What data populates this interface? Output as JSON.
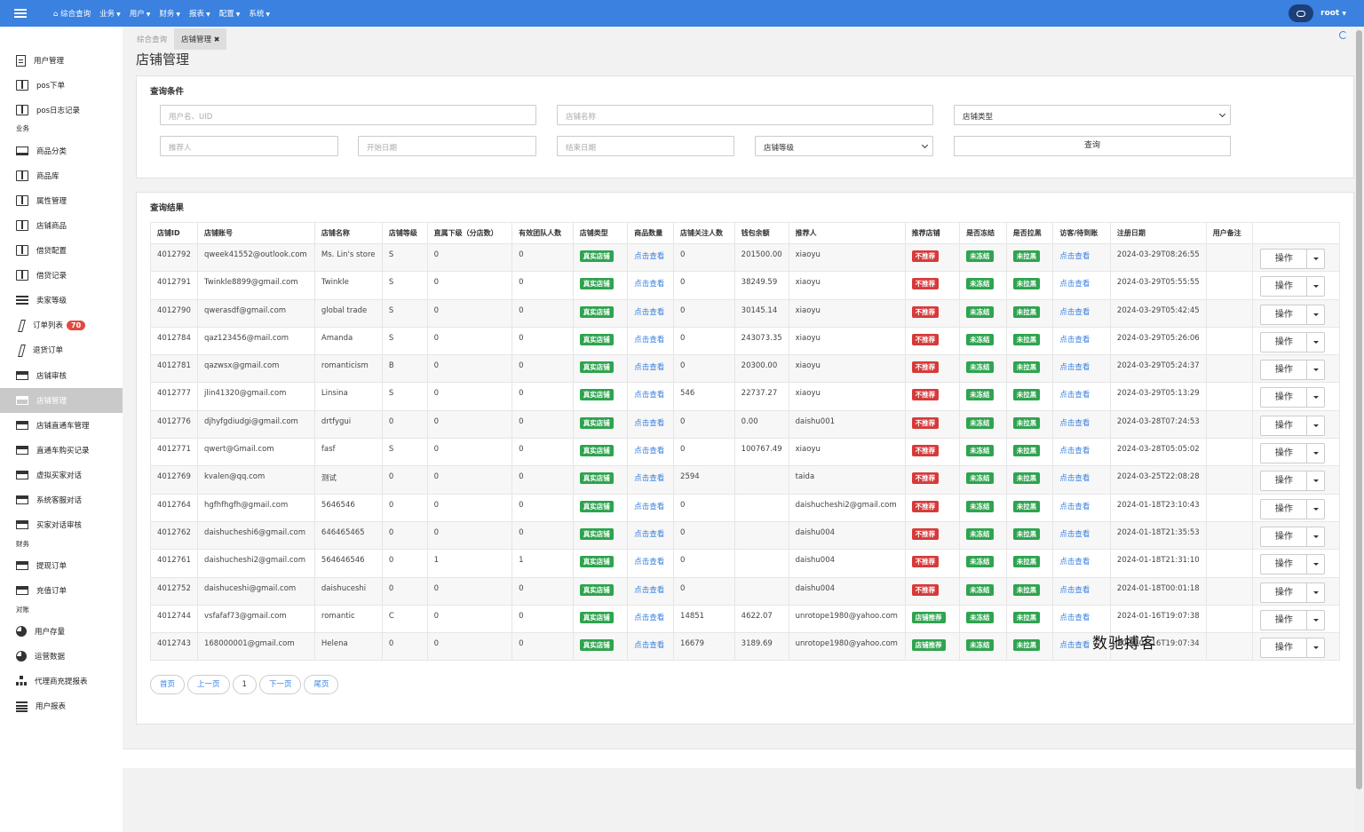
{
  "topbar": {
    "nav": [
      {
        "label": "综合查询",
        "icon": "home-icon",
        "caret": false
      },
      {
        "label": "业务",
        "caret": true
      },
      {
        "label": "用户",
        "caret": true
      },
      {
        "label": "财务",
        "caret": true
      },
      {
        "label": "报表",
        "caret": true
      },
      {
        "label": "配置",
        "caret": true
      },
      {
        "label": "系统",
        "caret": true
      }
    ],
    "user": "root",
    "accent_color": "#3a81e0"
  },
  "sidebar": {
    "items": [
      {
        "label": "用户管理",
        "icon": "file-icon"
      },
      {
        "label": "pos下单",
        "icon": "book-icon"
      },
      {
        "label": "pos日志记录",
        "icon": "book-icon"
      },
      {
        "label": "商品分类",
        "icon": "laptop-icon"
      },
      {
        "label": "商品库",
        "icon": "book-icon"
      },
      {
        "label": "属性管理",
        "icon": "book-icon"
      },
      {
        "label": "店铺商品",
        "icon": "book-icon"
      },
      {
        "label": "借贷配置",
        "icon": "book-icon"
      },
      {
        "label": "借贷记录",
        "icon": "book-icon"
      },
      {
        "label": "卖家等级",
        "icon": "list-icon"
      },
      {
        "label": "订单列表",
        "icon": "edit-icon",
        "badge": "70"
      },
      {
        "label": "退货订单",
        "icon": "edit-icon"
      },
      {
        "label": "店铺审核",
        "icon": "credit-card-icon"
      },
      {
        "label": "店铺管理",
        "icon": "credit-card-icon",
        "active": true
      },
      {
        "label": "店铺直通车管理",
        "icon": "credit-card-icon"
      },
      {
        "label": "直通车购买记录",
        "icon": "credit-card-icon"
      },
      {
        "label": "虚拟买家对话",
        "icon": "credit-card-icon"
      },
      {
        "label": "系统客服对话",
        "icon": "credit-card-icon"
      },
      {
        "label": "买家对话审核",
        "icon": "credit-card-icon"
      },
      {
        "label": "提现订单",
        "icon": "credit-card-icon"
      },
      {
        "label": "充值订单",
        "icon": "credit-card-icon"
      },
      {
        "label": "用户存量",
        "icon": "pie-chart-icon"
      },
      {
        "label": "运营数据",
        "icon": "pie-chart-icon"
      },
      {
        "label": "代理商充提报表",
        "icon": "sitemap-icon"
      },
      {
        "label": "用户报表",
        "icon": "align-left-icon"
      }
    ],
    "sections": [
      "业务",
      "财务",
      "对账"
    ]
  },
  "tabs": [
    {
      "label": "综合查询"
    },
    {
      "label": "店铺管理",
      "close": "✖"
    }
  ],
  "page_title": "店铺管理",
  "query": {
    "title": "查询条件",
    "user_placeholder": "用户名、UID",
    "shop_name_placeholder": "店铺名称",
    "shop_type_value": "店铺类型",
    "referrer_placeholder": "推荐人",
    "start_date_placeholder": "开始日期",
    "end_date_placeholder": "结束日期",
    "shop_level_value": "店铺等级",
    "search_label": "查询"
  },
  "results": {
    "title": "查询结果",
    "columns": [
      "店铺ID",
      "店铺账号",
      "店铺名称",
      "店铺等级",
      "直属下级（分店数）",
      "有效团队人数",
      "店铺类型",
      "商品数量",
      "店铺关注人数",
      "钱包余额",
      "推荐人",
      "推荐店铺",
      "是否冻结",
      "是否拉黑",
      "访客/待到账",
      "注册日期",
      "用户备注",
      ""
    ],
    "op_label": "操作",
    "rows": [
      {
        "id": "4012792",
        "account": "qweek41552@outlook.com",
        "name": "Ms. Lin's store",
        "level": "S",
        "subs": "0",
        "team": "0",
        "type": "真实店铺",
        "goods": "点击查看",
        "followers": "0",
        "balance": "201500.00",
        "referrer": "xiaoyu",
        "recommend": "不推荐",
        "recommend_color": "red",
        "frozen": "未冻结",
        "blacklist": "未拉黑",
        "visitors": "点击查看",
        "date": "2024-03-29T08:26:55",
        "note": ""
      },
      {
        "id": "4012791",
        "account": "Twinkle8899@gmail.com",
        "name": "Twinkle",
        "level": "S",
        "subs": "0",
        "team": "0",
        "type": "真实店铺",
        "goods": "点击查看",
        "followers": "0",
        "balance": "38249.59",
        "referrer": "xiaoyu",
        "recommend": "不推荐",
        "recommend_color": "red",
        "frozen": "未冻结",
        "blacklist": "未拉黑",
        "visitors": "点击查看",
        "date": "2024-03-29T05:55:55",
        "note": ""
      },
      {
        "id": "4012790",
        "account": "qwerasdf@gmail.com",
        "name": "global trade",
        "level": "S",
        "subs": "0",
        "team": "0",
        "type": "真实店铺",
        "goods": "点击查看",
        "followers": "0",
        "balance": "30145.14",
        "referrer": "xiaoyu",
        "recommend": "不推荐",
        "recommend_color": "red",
        "frozen": "未冻结",
        "blacklist": "未拉黑",
        "visitors": "点击查看",
        "date": "2024-03-29T05:42:45",
        "note": ""
      },
      {
        "id": "4012784",
        "account": "qaz123456@mail.com",
        "name": "Amanda",
        "level": "S",
        "subs": "0",
        "team": "0",
        "type": "真实店铺",
        "goods": "点击查看",
        "followers": "0",
        "balance": "243073.35",
        "referrer": "xiaoyu",
        "recommend": "不推荐",
        "recommend_color": "red",
        "frozen": "未冻结",
        "blacklist": "未拉黑",
        "visitors": "点击查看",
        "date": "2024-03-29T05:26:06",
        "note": ""
      },
      {
        "id": "4012781",
        "account": "qazwsx@gmail.com",
        "name": "romanticism",
        "level": "B",
        "subs": "0",
        "team": "0",
        "type": "真实店铺",
        "goods": "点击查看",
        "followers": "0",
        "balance": "20300.00",
        "referrer": "xiaoyu",
        "recommend": "不推荐",
        "recommend_color": "red",
        "frozen": "未冻结",
        "blacklist": "未拉黑",
        "visitors": "点击查看",
        "date": "2024-03-29T05:24:37",
        "note": ""
      },
      {
        "id": "4012777",
        "account": "jlin41320@gmail.com",
        "name": "Linsina",
        "level": "S",
        "subs": "0",
        "team": "0",
        "type": "真实店铺",
        "goods": "点击查看",
        "followers": "546",
        "balance": "22737.27",
        "referrer": "xiaoyu",
        "recommend": "不推荐",
        "recommend_color": "red",
        "frozen": "未冻结",
        "blacklist": "未拉黑",
        "visitors": "点击查看",
        "date": "2024-03-29T05:13:29",
        "note": ""
      },
      {
        "id": "4012776",
        "account": "djhyfgdiudgi@gmail.com",
        "name": "drtfygui",
        "level": "0",
        "subs": "0",
        "team": "0",
        "type": "真实店铺",
        "goods": "点击查看",
        "followers": "0",
        "balance": "0.00",
        "referrer": "daishu001",
        "recommend": "不推荐",
        "recommend_color": "red",
        "frozen": "未冻结",
        "blacklist": "未拉黑",
        "visitors": "点击查看",
        "date": "2024-03-28T07:24:53",
        "note": ""
      },
      {
        "id": "4012771",
        "account": "qwert@Gmail.com",
        "name": "fasf",
        "level": "S",
        "subs": "0",
        "team": "0",
        "type": "真实店铺",
        "goods": "点击查看",
        "followers": "0",
        "balance": "100767.49",
        "referrer": "xiaoyu",
        "recommend": "不推荐",
        "recommend_color": "red",
        "frozen": "未冻结",
        "blacklist": "未拉黑",
        "visitors": "点击查看",
        "date": "2024-03-28T05:05:02",
        "note": ""
      },
      {
        "id": "4012769",
        "account": "kvalen@qq.com",
        "name": "测试",
        "level": "0",
        "subs": "0",
        "team": "0",
        "type": "真实店铺",
        "goods": "点击查看",
        "followers": "2594",
        "balance": "",
        "referrer": "taida",
        "recommend": "不推荐",
        "recommend_color": "red",
        "frozen": "未冻结",
        "blacklist": "未拉黑",
        "visitors": "点击查看",
        "date": "2024-03-25T22:08:28",
        "note": ""
      },
      {
        "id": "4012764",
        "account": "hgfhfhgfh@gmail.com",
        "name": "5646546",
        "level": "0",
        "subs": "0",
        "team": "0",
        "type": "真实店铺",
        "goods": "点击查看",
        "followers": "0",
        "balance": "",
        "referrer": "daishucheshi2@gmail.com",
        "recommend": "不推荐",
        "recommend_color": "red",
        "frozen": "未冻结",
        "blacklist": "未拉黑",
        "visitors": "点击查看",
        "date": "2024-01-18T23:10:43",
        "note": ""
      },
      {
        "id": "4012762",
        "account": "daishucheshi6@gmail.com",
        "name": "646465465",
        "level": "0",
        "subs": "0",
        "team": "0",
        "type": "真实店铺",
        "goods": "点击查看",
        "followers": "0",
        "balance": "",
        "referrer": "daishu004",
        "recommend": "不推荐",
        "recommend_color": "red",
        "frozen": "未冻结",
        "blacklist": "未拉黑",
        "visitors": "点击查看",
        "date": "2024-01-18T21:35:53",
        "note": ""
      },
      {
        "id": "4012761",
        "account": "daishucheshi2@gmail.com",
        "name": "564646546",
        "level": "0",
        "subs": "1",
        "team": "1",
        "type": "真实店铺",
        "goods": "点击查看",
        "followers": "0",
        "balance": "",
        "referrer": "daishu004",
        "recommend": "不推荐",
        "recommend_color": "red",
        "frozen": "未冻结",
        "blacklist": "未拉黑",
        "visitors": "点击查看",
        "date": "2024-01-18T21:31:10",
        "note": ""
      },
      {
        "id": "4012752",
        "account": "daishuceshi@gmail.com",
        "name": "daishuceshi",
        "level": "0",
        "subs": "0",
        "team": "0",
        "type": "真实店铺",
        "goods": "点击查看",
        "followers": "0",
        "balance": "",
        "referrer": "daishu004",
        "recommend": "不推荐",
        "recommend_color": "red",
        "frozen": "未冻结",
        "blacklist": "未拉黑",
        "visitors": "点击查看",
        "date": "2024-01-18T00:01:18",
        "note": ""
      },
      {
        "id": "4012744",
        "account": "vsfafaf73@gmail.com",
        "name": "romantic",
        "level": "C",
        "subs": "0",
        "team": "0",
        "type": "真实店铺",
        "goods": "点击查看",
        "followers": "14851",
        "balance": "4622.07",
        "referrer": "unrotope1980@yahoo.com",
        "recommend": "店铺推荐",
        "recommend_color": "green",
        "frozen": "未冻结",
        "blacklist": "未拉黑",
        "visitors": "点击查看",
        "date": "2024-01-16T19:07:38",
        "note": ""
      },
      {
        "id": "4012743",
        "account": "168000001@gmail.com",
        "name": "Helena",
        "level": "0",
        "subs": "0",
        "team": "0",
        "type": "真实店铺",
        "goods": "点击查看",
        "followers": "16679",
        "balance": "3189.69",
        "referrer": "unrotope1980@yahoo.com",
        "recommend": "店铺推荐",
        "recommend_color": "green",
        "frozen": "未冻结",
        "blacklist": "未拉黑",
        "visitors": "点击查看",
        "date": "2024-01-16T19:07:34",
        "note": ""
      }
    ]
  },
  "pagination": {
    "first": "首页",
    "prev": "上一页",
    "current": "1",
    "next": "下一页",
    "last": "尾页"
  },
  "watermark": "数驰搏客",
  "colors": {
    "label_green": "#2ea44f",
    "label_red": "#d73a3a",
    "link": "#3a81e0"
  }
}
